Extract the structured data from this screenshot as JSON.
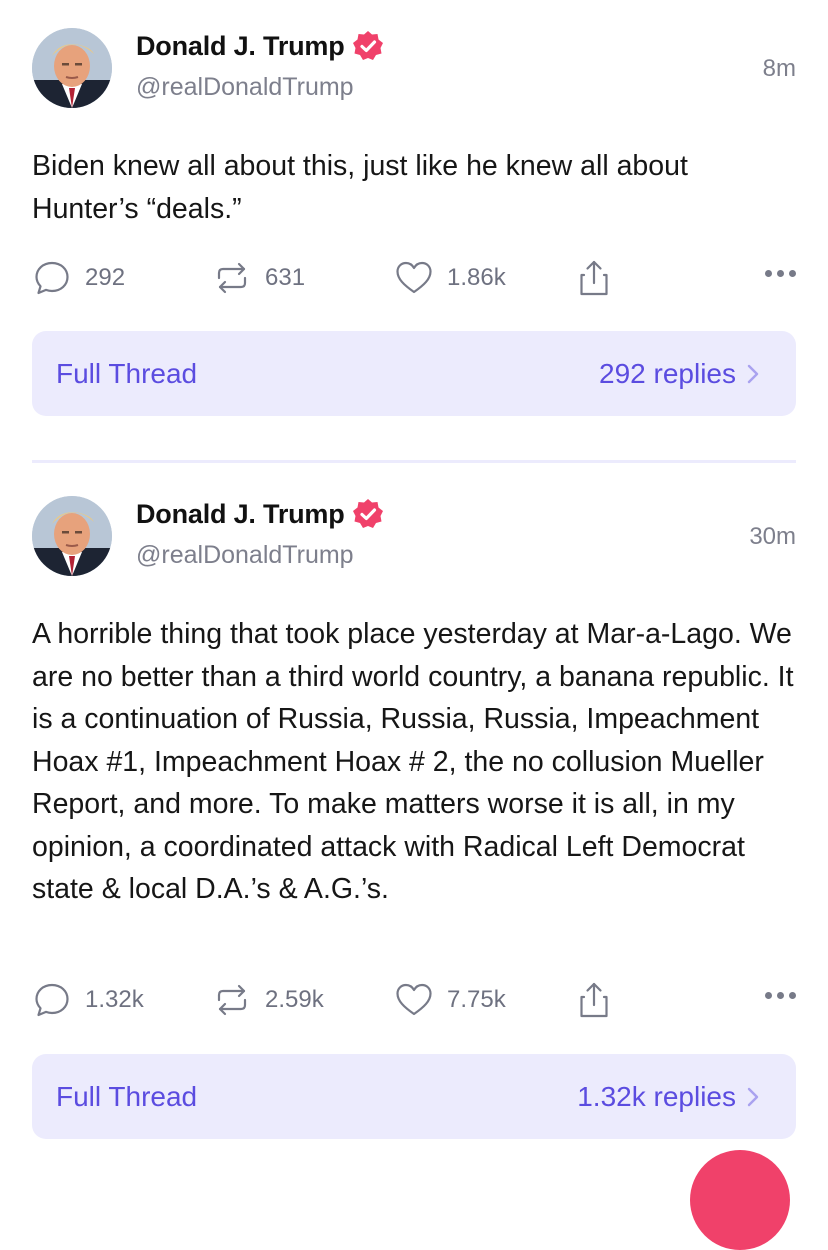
{
  "posts": [
    {
      "author_name": "Donald J. Trump",
      "author_handle": "@realDonaldTrump",
      "time": "8m",
      "text": "Biden knew all about this, just like he knew all about Hunter’s “deals.”",
      "replies": "292",
      "retruths": "631",
      "likes": "1.86k",
      "thread_label": "Full Thread",
      "thread_replies": "292 replies"
    },
    {
      "author_name": "Donald J. Trump",
      "author_handle": "@realDonaldTrump",
      "time": "30m",
      "text": "A horrible thing that took place yesterday at Mar-a-Lago. We are no better than a third world country, a banana republic. It is a continuation of Russia, Russia, Russia, Impeachment Hoax #1, Impeachment Hoax # 2, the no collusion Mueller Report, and more. To make matters worse it is all, in my opinion, a coordinated attack with Radical Left Democrat state & local D.A.’s & A.G.’s.",
      "replies": "1.32k",
      "retruths": "2.59k",
      "likes": "7.75k",
      "thread_label": "Full Thread",
      "thread_replies": "1.32k replies"
    }
  ],
  "icons": {
    "verified": "verified-badge-icon",
    "reply": "speech-bubble-icon",
    "retruth": "repost-arrows-icon",
    "like": "heart-icon",
    "share": "share-icon",
    "more": "ellipsis-icon",
    "chevron": "chevron-right-icon"
  },
  "colors": {
    "accent": "#5b4ce0",
    "thread_bg": "#ecebfd",
    "verified": "#f0416a",
    "muted": "#7d7f8c"
  }
}
